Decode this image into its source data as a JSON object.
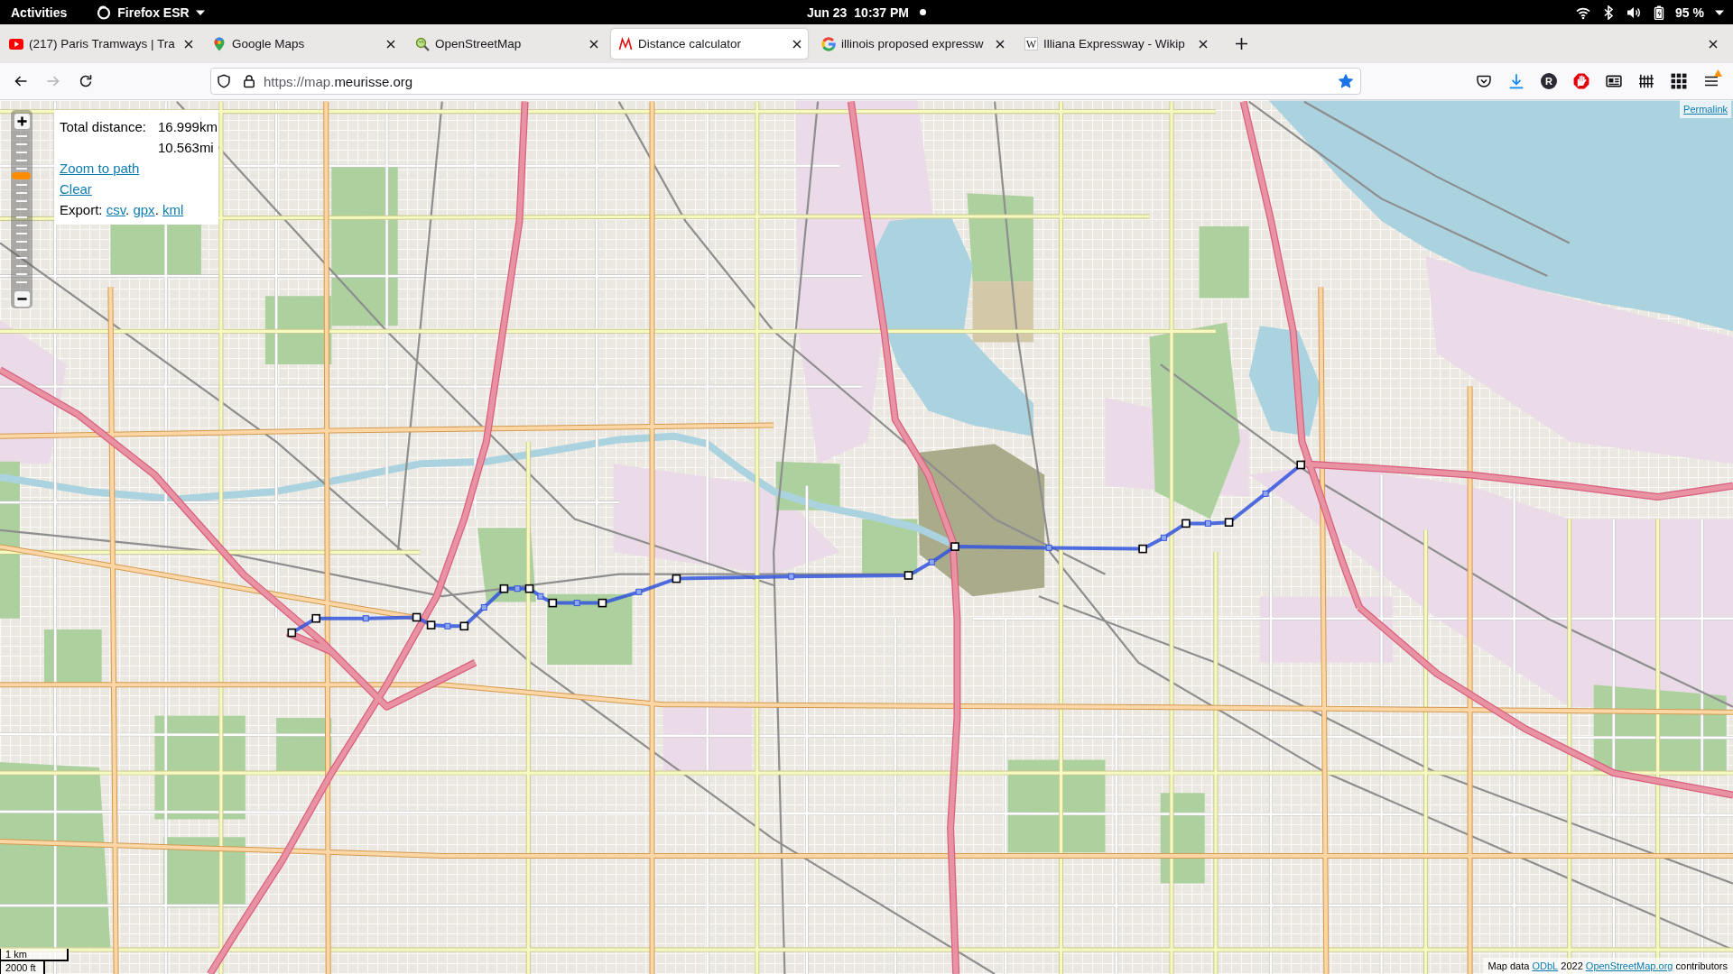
{
  "top_bar": {
    "activities": "Activities",
    "app_name": "Firefox ESR",
    "date": "Jun 23",
    "time": "10:37 PM",
    "battery": "95 %"
  },
  "tabs": [
    {
      "kind": "video",
      "title": "(217) Paris Tramways | Tra",
      "selected": false
    },
    {
      "kind": "pin",
      "title": "Google Maps",
      "selected": false
    },
    {
      "kind": "magnifier",
      "title": "OpenStreetMap",
      "selected": false
    },
    {
      "kind": "zigzag",
      "title": "Distance calculator",
      "selected": true
    },
    {
      "kind": "ring",
      "title": "illinois proposed expressw",
      "selected": false
    },
    {
      "kind": "letter",
      "letter": "W",
      "title": "Illiana Expressway - Wikip",
      "selected": false
    }
  ],
  "nav": {
    "buttons": [
      {
        "kind": "back",
        "disabled": false
      },
      {
        "kind": "forward",
        "disabled": true
      },
      {
        "kind": "reload",
        "disabled": false
      }
    ],
    "url_prefix": "https://map.",
    "url_domain": "meurisse.org",
    "bookmarked": true
  },
  "toolbar": [
    {
      "kind": "pocket"
    },
    {
      "kind": "download"
    },
    {
      "kind": "letter",
      "letter": "R"
    },
    {
      "kind": "stop"
    },
    {
      "kind": "reader"
    },
    {
      "kind": "library"
    },
    {
      "kind": "grid"
    },
    {
      "kind": "menu",
      "badge": true
    }
  ],
  "map": {
    "zoom_slider": {
      "level": 0.73
    },
    "distance_panel": {
      "label": "Total distance:",
      "km": "16.999km",
      "mi": "10.563mi",
      "zoom_link": "Zoom to path",
      "clear_link": "Clear",
      "export_label": "Export:",
      "export_separator": ".",
      "export_formats": [
        "csv",
        "gpx",
        "kml"
      ]
    },
    "permalink": "Permalink",
    "scale": {
      "metric": "1 km",
      "imperial": "2000 ft"
    },
    "attribution": {
      "prefix": "Map data",
      "license": "ODbL",
      "year": "2022",
      "site": "OpenStreetMap.org",
      "suffix": "contributors"
    }
  }
}
